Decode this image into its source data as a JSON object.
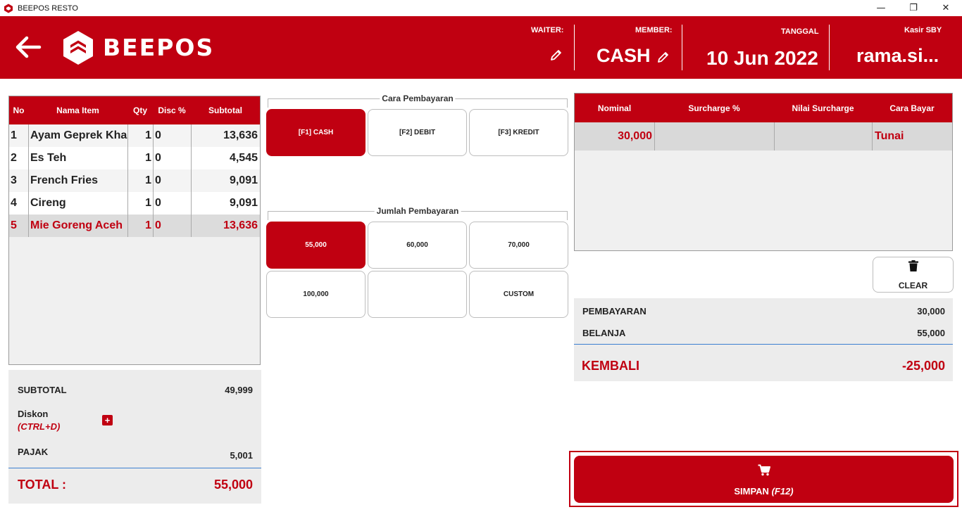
{
  "window": {
    "title": "BEEPOS RESTO",
    "minimize": "—",
    "maximize": "❐",
    "close": "✕"
  },
  "header": {
    "logo_text": "BEEPOS",
    "waiter_label": "WAITER:",
    "member_label": "MEMBER:",
    "member_value": "CASH",
    "date_label": "TANGGAL",
    "date_value": "10 Jun 2022",
    "cashier_label": "Kasir SBY",
    "cashier_value": "rama.si..."
  },
  "order": {
    "columns": [
      "No",
      "Nama Item",
      "Qty",
      "Disc %",
      "Subtotal"
    ],
    "rows": [
      {
        "no": "1",
        "name": "Ayam Geprek Kha",
        "qty": "1",
        "disc": "0",
        "subtotal": "13,636"
      },
      {
        "no": "2",
        "name": "Es Teh",
        "qty": "1",
        "disc": "0",
        "subtotal": "4,545"
      },
      {
        "no": "3",
        "name": "French Fries",
        "qty": "1",
        "disc": "0",
        "subtotal": "9,091"
      },
      {
        "no": "4",
        "name": "Cireng",
        "qty": "1",
        "disc": "0",
        "subtotal": "9,091"
      },
      {
        "no": "5",
        "name": "Mie Goreng Aceh",
        "qty": "1",
        "disc": "0",
        "subtotal": "13,636"
      }
    ]
  },
  "summary": {
    "subtotal_label": "SUBTOTAL",
    "subtotal_value": "49,999",
    "discount_label": "Diskon",
    "discount_shortcut": "(CTRL+D)",
    "discount_add": "+",
    "tax_label": "PAJAK",
    "tax_value": "5,001",
    "total_label": "TOTAL :",
    "total_value": "55,000"
  },
  "payment_method": {
    "title": "Cara Pembayaran",
    "options": [
      "[F1] CASH",
      "[F2] DEBIT",
      "[F3] KREDIT"
    ],
    "selected": "[F1] CASH"
  },
  "payment_amount": {
    "title": "Jumlah Pembayaran",
    "options": [
      "55,000",
      "60,000",
      "70,000",
      "100,000",
      "",
      "CUSTOM"
    ],
    "selected": "55,000"
  },
  "payments": {
    "columns": [
      "Nominal",
      "Surcharge %",
      "Nilai Surcharge",
      "Cara Bayar"
    ],
    "rows": [
      {
        "nominal": "30,000",
        "surcharge_pct": "",
        "surcharge_value": "",
        "method": "Tunai"
      }
    ]
  },
  "clear_label": "CLEAR",
  "change": {
    "paid_label": "PEMBAYARAN",
    "paid_value": "30,000",
    "spend_label": "BELANJA",
    "spend_value": "55,000",
    "change_label": "KEMBALI",
    "change_value": "-25,000"
  },
  "save": {
    "label": "SIMPAN",
    "shortcut": "(F12)"
  },
  "colors": {
    "brand": "#c00011",
    "panel": "#ececec",
    "divider": "#3b7fd0"
  },
  "icons": [
    "app-logo-icon",
    "back-arrow-icon",
    "beepos-logo-icon",
    "pencil-icon",
    "trash-icon",
    "cart-icon",
    "plus-icon"
  ]
}
